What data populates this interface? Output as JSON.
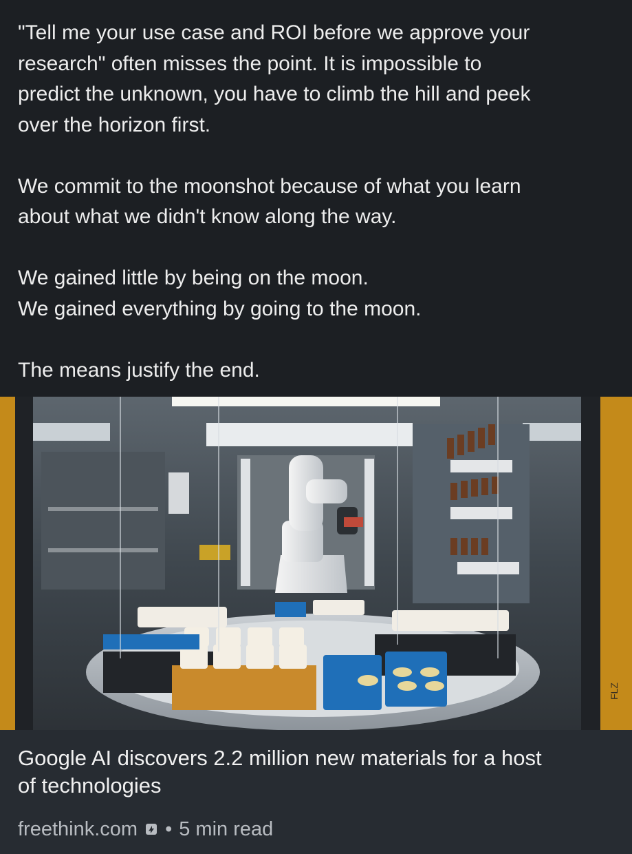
{
  "post": {
    "paragraphs": [
      {
        "lines": [
          "\"Tell me your use case and ROI before we approve your",
          "research\" often misses the point.  It is impossible to",
          "predict the unknown, you have to climb the hill and peek",
          "over the horizon first."
        ]
      },
      {
        "lines": [
          "We commit to the moonshot because of what you learn",
          "about what we didn't know along the way."
        ]
      },
      {
        "lines": [
          "We gained little by being on the moon.",
          "We gained everything by going to the moon."
        ]
      },
      {
        "lines": [
          "The means justify the end."
        ]
      }
    ]
  },
  "image": {
    "description_icon": "robot-lab-photo",
    "corner_text": "FLZ"
  },
  "link": {
    "title_line1": "Google AI discovers 2.2 million new materials for a host",
    "title_line2": "of technologies",
    "domain": "freethink.com",
    "separator": "•",
    "read_time": "5 min read",
    "verified_icon": "link-badge-icon"
  },
  "colors": {
    "background": "#1c1f23",
    "card": "#272c32",
    "text": "#ededed",
    "meta": "#b8bcc1"
  }
}
